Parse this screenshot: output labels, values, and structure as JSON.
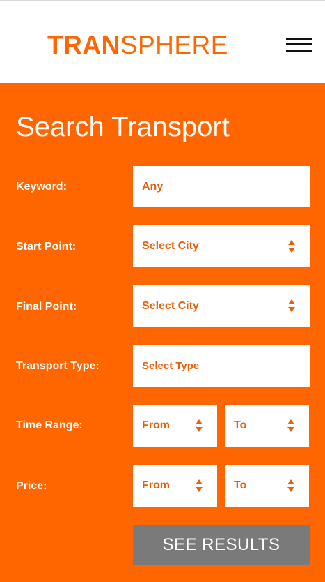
{
  "header": {
    "logo_bold": "TRAN",
    "logo_thin": "SPHERE",
    "brand_color": "#ff6600",
    "menu_icon": "hamburger-menu-icon"
  },
  "search": {
    "title": "Search Transport",
    "keyword": {
      "label": "Keyword:",
      "value": "Any"
    },
    "start_point": {
      "label": "Start Point:",
      "value": "Select City"
    },
    "final_point": {
      "label": "Final Point:",
      "value": "Select City"
    },
    "transport_type": {
      "label": "Transport Type:",
      "value": "Select Type"
    },
    "time_range": {
      "label": "Time Range:",
      "from": "From",
      "to": "To"
    },
    "price": {
      "label": "Price:",
      "from": "From",
      "to": "To"
    },
    "submit_label": "SEE RESULTS",
    "panel_color": "#ff6600",
    "button_color": "#7a7a7a"
  }
}
